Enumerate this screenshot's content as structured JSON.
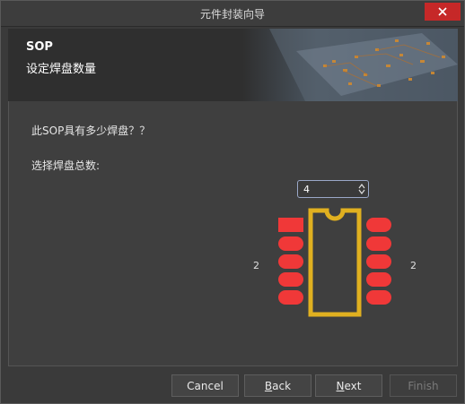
{
  "window": {
    "title": "元件封装向导"
  },
  "header": {
    "title": "SOP",
    "subtitle": "设定焊盘数量"
  },
  "content": {
    "question": "此SOP具有多少焊盘？？",
    "total_label": "选择焊盘总数:",
    "pad_count": "4",
    "left_count": "2",
    "right_count": "2"
  },
  "buttons": {
    "cancel": "Cancel",
    "back_first": "B",
    "back_rest": "ack",
    "next_first": "N",
    "next_rest": "ext",
    "finish": "Finish"
  },
  "colors": {
    "pad": "#f03838",
    "outline": "#e0b020",
    "close": "#c62828"
  },
  "icons": {
    "close": "close-icon",
    "spin_up": "chevron-up-icon",
    "spin_down": "chevron-down-icon"
  }
}
